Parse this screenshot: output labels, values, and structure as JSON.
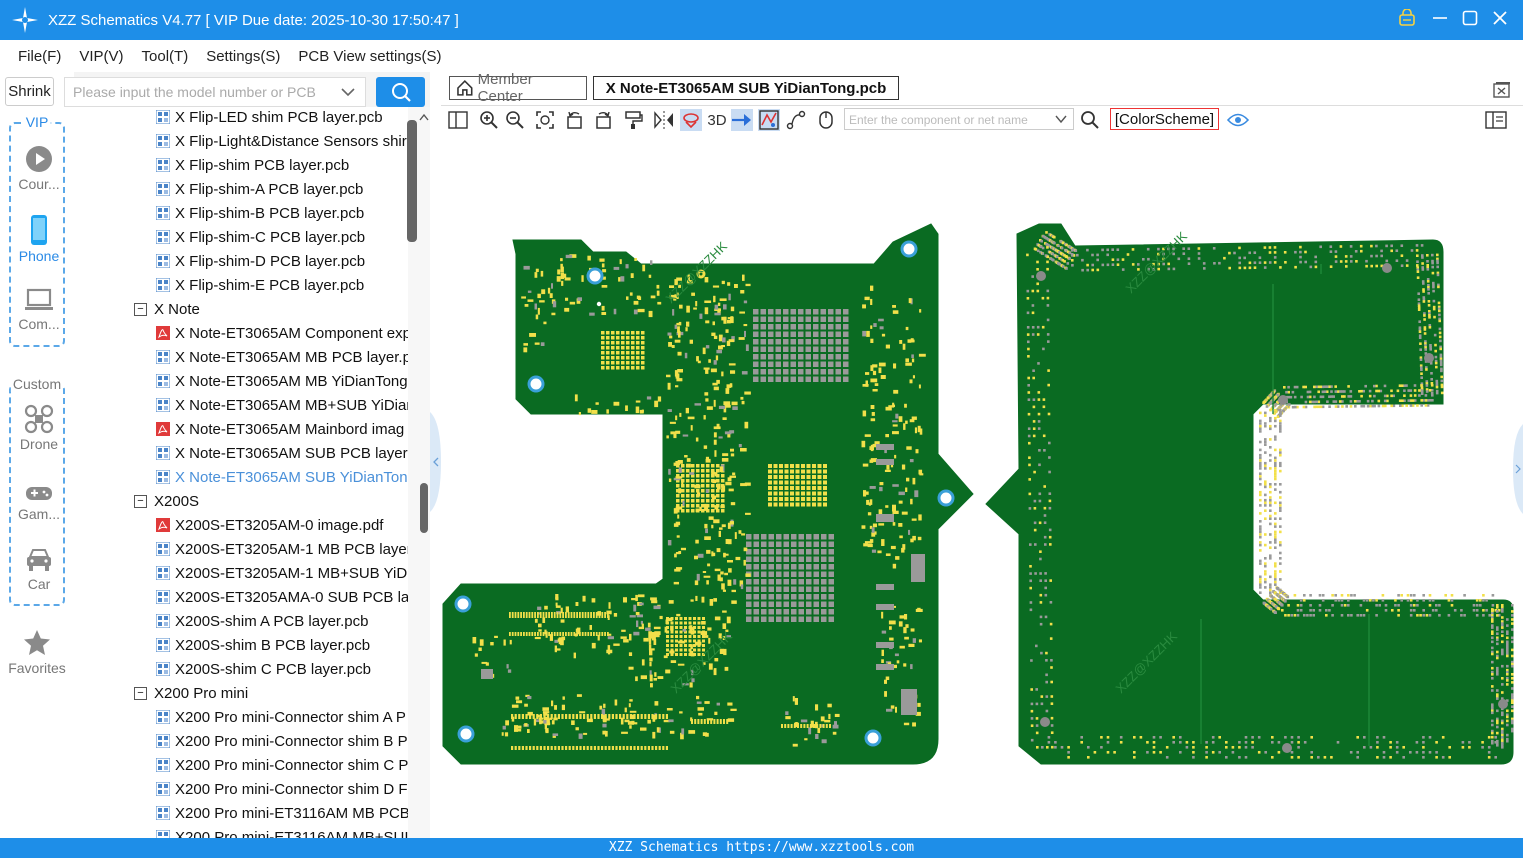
{
  "window": {
    "title": "XZZ Schematics V4.77 [ VIP Due date: 2025-10-30 17:50:47 ]",
    "controls": [
      "lock-icon",
      "minimize",
      "maximize",
      "close"
    ]
  },
  "menu": {
    "items": [
      "File(F)",
      "VIP(V)",
      "Tool(T)",
      "Settings(S)",
      "PCB View settings(S)"
    ]
  },
  "sidebar": {
    "shrink_label": "Shrink",
    "vip_group_label": "VIP",
    "custom_group_label": "Custom",
    "items": [
      {
        "label": "Cour...",
        "icon": "play-icon"
      },
      {
        "label": "Phone",
        "icon": "phone-icon",
        "active": true
      },
      {
        "label": "Com...",
        "icon": "laptop-icon"
      },
      {
        "label": "Drone",
        "icon": "drone-icon"
      },
      {
        "label": "Gam...",
        "icon": "gamepad-icon"
      },
      {
        "label": "Car",
        "icon": "car-icon"
      }
    ],
    "favorites_label": "Favorites"
  },
  "search": {
    "placeholder": "Please input the model number or PCB"
  },
  "tree": {
    "rows": [
      {
        "type": "file",
        "kind": "pcb",
        "label": "X Flip-LED shim PCB layer.pcb"
      },
      {
        "type": "file",
        "kind": "pcb",
        "label": "X Flip-Light&Distance Sensors shir"
      },
      {
        "type": "file",
        "kind": "pcb",
        "label": "X Flip-shim PCB layer.pcb"
      },
      {
        "type": "file",
        "kind": "pcb",
        "label": "X Flip-shim-A PCB layer.pcb"
      },
      {
        "type": "file",
        "kind": "pcb",
        "label": "X Flip-shim-B PCB layer.pcb"
      },
      {
        "type": "file",
        "kind": "pcb",
        "label": "X Flip-shim-C PCB layer.pcb"
      },
      {
        "type": "file",
        "kind": "pcb",
        "label": "X Flip-shim-D PCB layer.pcb"
      },
      {
        "type": "file",
        "kind": "pcb",
        "label": "X Flip-shim-E PCB layer.pcb"
      },
      {
        "type": "folder",
        "label": "X Note"
      },
      {
        "type": "file",
        "kind": "pdf",
        "label": "X Note-ET3065AM Component exp"
      },
      {
        "type": "file",
        "kind": "pcb",
        "label": "X Note-ET3065AM MB PCB layer.p"
      },
      {
        "type": "file",
        "kind": "pcb",
        "label": "X Note-ET3065AM MB YiDianTong"
      },
      {
        "type": "file",
        "kind": "pcb",
        "label": "X Note-ET3065AM MB+SUB YiDiar"
      },
      {
        "type": "file",
        "kind": "pdf",
        "label": "X Note-ET3065AM Mainbord imag"
      },
      {
        "type": "file",
        "kind": "pcb",
        "label": "X Note-ET3065AM SUB PCB layer.p"
      },
      {
        "type": "file",
        "kind": "pcb",
        "label": "X Note-ET3065AM SUB YiDianTon",
        "selected": true
      },
      {
        "type": "folder",
        "label": "X200S"
      },
      {
        "type": "file",
        "kind": "pdf",
        "label": "X200S-ET3205AM-0 image.pdf"
      },
      {
        "type": "file",
        "kind": "pcb",
        "label": "X200S-ET3205AM-1 MB PCB layer."
      },
      {
        "type": "file",
        "kind": "pcb",
        "label": "X200S-ET3205AM-1 MB+SUB YiDi"
      },
      {
        "type": "file",
        "kind": "pcb",
        "label": "X200S-ET3205AMA-0 SUB PCB laye"
      },
      {
        "type": "file",
        "kind": "pcb",
        "label": "X200S-shim A PCB layer.pcb"
      },
      {
        "type": "file",
        "kind": "pcb",
        "label": "X200S-shim B PCB layer.pcb"
      },
      {
        "type": "file",
        "kind": "pcb",
        "label": "X200S-shim C PCB layer.pcb"
      },
      {
        "type": "folder",
        "label": "X200 Pro mini"
      },
      {
        "type": "file",
        "kind": "pcb",
        "label": "X200 Pro mini-Connector shim A P"
      },
      {
        "type": "file",
        "kind": "pcb",
        "label": "X200 Pro mini-Connector shim B P"
      },
      {
        "type": "file",
        "kind": "pcb",
        "label": "X200 Pro mini-Connector shim C P"
      },
      {
        "type": "file",
        "kind": "pcb",
        "label": "X200 Pro mini-Connector shim D F"
      },
      {
        "type": "file",
        "kind": "pcb",
        "label": "X200 Pro mini-ET3116AM MB PCB"
      },
      {
        "type": "file",
        "kind": "pcb",
        "label": "X200 Pro mini-ET3116AM MB+SUI"
      }
    ]
  },
  "tabs": {
    "member_label": "Member Center",
    "active_label": "X Note-ET3065AM SUB YiDianTong.pcb"
  },
  "toolbar": {
    "label_3d": "3D",
    "component_placeholder": "Enter the component or net name",
    "colorscheme_label": "[ColorScheme]"
  },
  "board": {
    "watermark": "XZZ@XZZHK",
    "colors": {
      "pcb": "#0a6b22",
      "pad": "#f2e04a",
      "pad_gray": "#9a9a9a",
      "hole": "#ffffff"
    }
  },
  "status": {
    "text": "XZZ Schematics https://www.xzztools.com"
  }
}
